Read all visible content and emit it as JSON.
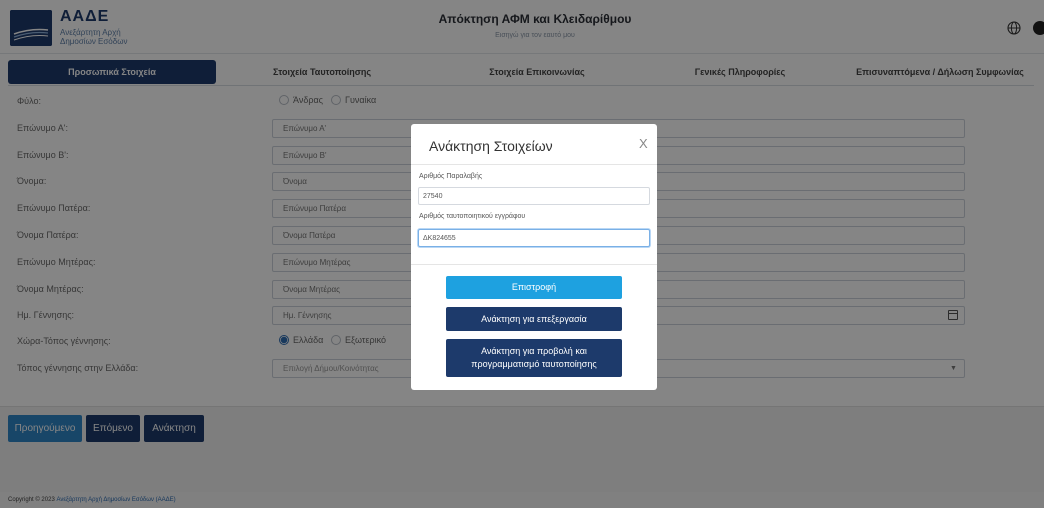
{
  "header": {
    "logo_title": "ΑΑΔΕ",
    "logo_subtitle": "Ανεξάρτητη Αρχή Δημοσίων Εσόδων",
    "title": "Απόκτηση ΑΦΜ και Κλειδαρίθμου",
    "subtitle": "Εισηγώ για τον εαυτό μου"
  },
  "tabs": [
    {
      "label": "Προσωπικά Στοιχεία",
      "active": true
    },
    {
      "label": "Στοιχεία Ταυτοποίησης",
      "active": false
    },
    {
      "label": "Στοιχεία Επικοινωνίας",
      "active": false
    },
    {
      "label": "Γενικές Πληροφορίες",
      "active": false
    },
    {
      "label": "Επισυναπτόμενα / Δήλωση Συμφωνίας",
      "active": false
    }
  ],
  "form": {
    "gender": {
      "label": "Φύλο:",
      "options": [
        "Άνδρας",
        "Γυναίκα"
      ]
    },
    "surname_a": {
      "label": "Επώνυμο Α':",
      "placeholder": "Επώνυμο Α'"
    },
    "surname_b": {
      "label": "Επώνυμο Β':",
      "placeholder": "Επώνυμο Β'"
    },
    "first_name": {
      "label": "Όνομα:",
      "placeholder": "Όνομα"
    },
    "father_surname": {
      "label": "Επώνυμο Πατέρα:",
      "placeholder": "Επώνυμο Πατέρα"
    },
    "father_name": {
      "label": "Όνομα Πατέρα:",
      "placeholder": "Όνομα Πατέρα"
    },
    "mother_surname": {
      "label": "Επώνυμο Μητέρας:",
      "placeholder": "Επώνυμο Μητέρας"
    },
    "mother_name": {
      "label": "Όνομα Μητέρας:",
      "placeholder": "Όνομα Μητέρας"
    },
    "birth_date": {
      "label": "Ημ. Γέννησης:",
      "placeholder": "Ημ. Γέννησης"
    },
    "birth_country": {
      "label": "Χώρα-Τόπος γέννησης:",
      "options": [
        "Ελλάδα",
        "Εξωτερικό"
      ],
      "selected": "Ελλάδα"
    },
    "birth_place": {
      "label": "Τόπος γέννησης στην Ελλάδα:",
      "selected": "Επιλογή Δήμου/Κοινότητας"
    }
  },
  "buttons": {
    "previous": "Προηγούμενο",
    "next": "Επόμενο",
    "recover": "Ανάκτηση"
  },
  "footer": {
    "copyright": "Copyright © 2023",
    "link": "Ανεξάρτητη Αρχή Δημοσίων Εσόδων (ΑΑΔΕ)"
  },
  "modal": {
    "title": "Ανάκτηση Στοιχείων",
    "close": "X",
    "receipt_label": "Αριθμός Παραλαβής",
    "receipt_value": "27540",
    "doc_label": "Αριθμός ταυτοποιητικού εγγράφου",
    "doc_value": "ΔΚ824655",
    "back_button": "Επιστροφή",
    "edit_button": "Ανάκτηση για επεξεργασία",
    "view_button_line1": "Ανάκτηση για προβολή και",
    "view_button_line2": "προγραμματισμό ταυτοποίησης"
  },
  "colors": {
    "primary": "#1d3a6b",
    "accent": "#1ea1e0",
    "link": "#2f6db3"
  }
}
